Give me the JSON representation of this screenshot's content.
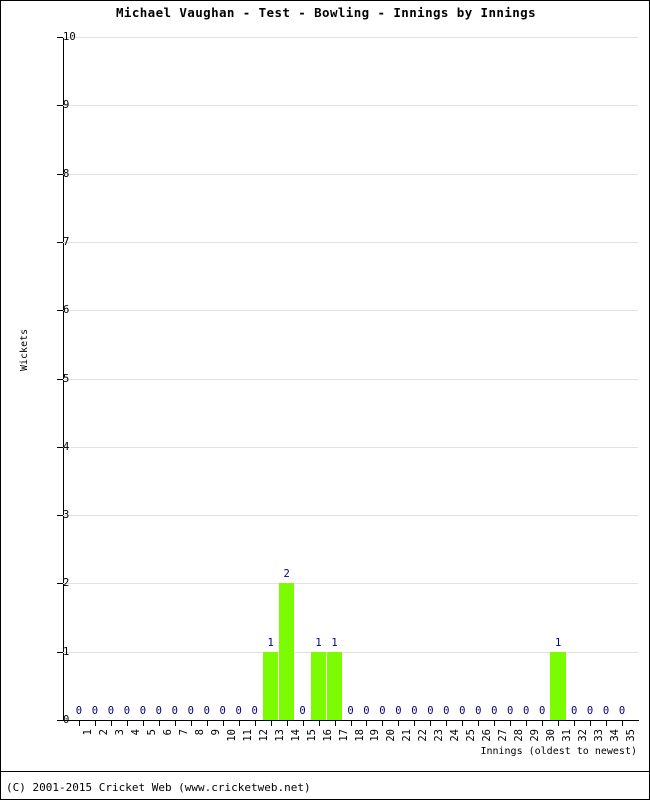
{
  "chart_data": {
    "type": "bar",
    "title": "Michael Vaughan - Test - Bowling - Innings by Innings",
    "xlabel": "Innings (oldest to newest)",
    "ylabel": "Wickets",
    "ylim": [
      0,
      10
    ],
    "ytick_labels": [
      "0",
      "1",
      "2",
      "3",
      "4",
      "5",
      "6",
      "7",
      "8",
      "9",
      "10"
    ],
    "ytick_values": [
      0,
      1,
      2,
      3,
      4,
      5,
      6,
      7,
      8,
      9,
      10
    ],
    "grid": true,
    "legend": null,
    "bar_color": "#7CFC00",
    "value_label_color": "#000080",
    "categories": [
      "1",
      "2",
      "3",
      "4",
      "5",
      "6",
      "7",
      "8",
      "9",
      "10",
      "11",
      "12",
      "13",
      "14",
      "15",
      "16",
      "17",
      "18",
      "19",
      "20",
      "21",
      "22",
      "23",
      "24",
      "25",
      "26",
      "27",
      "28",
      "29",
      "30",
      "31",
      "32",
      "33",
      "34",
      "35"
    ],
    "values": [
      0,
      0,
      0,
      0,
      0,
      0,
      0,
      0,
      0,
      0,
      0,
      0,
      1,
      2,
      0,
      1,
      1,
      0,
      0,
      0,
      0,
      0,
      0,
      0,
      0,
      0,
      0,
      0,
      0,
      0,
      1,
      0,
      0,
      0,
      0
    ],
    "value_labels": [
      "0",
      "0",
      "0",
      "0",
      "0",
      "0",
      "0",
      "0",
      "0",
      "0",
      "0",
      "0",
      "1",
      "2",
      "0",
      "1",
      "1",
      "0",
      "0",
      "0",
      "0",
      "0",
      "0",
      "0",
      "0",
      "0",
      "0",
      "0",
      "0",
      "0",
      "1",
      "0",
      "0",
      "0",
      "0"
    ]
  },
  "footer": {
    "copyright": "(C) 2001-2015 Cricket Web (www.cricketweb.net)"
  }
}
